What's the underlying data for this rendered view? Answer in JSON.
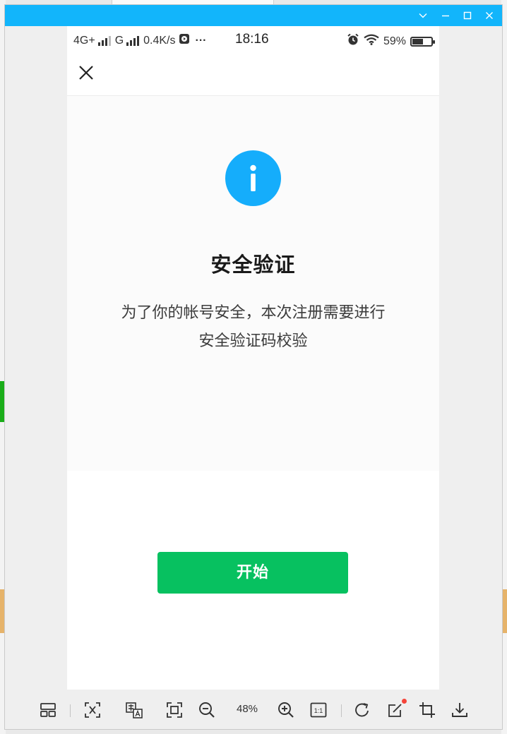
{
  "window": {
    "controls": [
      "chevron-down-icon",
      "minimize-icon",
      "maximize-icon",
      "close-icon"
    ],
    "titlebar_color": "#12b5fb"
  },
  "status_bar": {
    "network1": "4G+",
    "network2": "G",
    "speed": "0.4K/s",
    "more": "···",
    "time": "18:16",
    "battery_text": "59%",
    "battery_level": 0.59
  },
  "dialog": {
    "close_icon": "close-icon",
    "info_icon": "info-icon",
    "title": "安全验证",
    "desc_line1": "为了你的帐号安全，本次注册需要进行",
    "desc_line2": "安全验证码校验",
    "start_label": "开始",
    "accent_color": "#15adfb",
    "button_color": "#07c160"
  },
  "toolbar": {
    "zoom_label": "48%",
    "icons": [
      "layout-icon",
      "ocr-icon",
      "translate-icon",
      "fit-screen-icon",
      "zoom-out-icon",
      "zoom-in-icon",
      "actual-size-icon",
      "rotate-icon",
      "edit-icon",
      "crop-icon",
      "download-icon"
    ]
  }
}
